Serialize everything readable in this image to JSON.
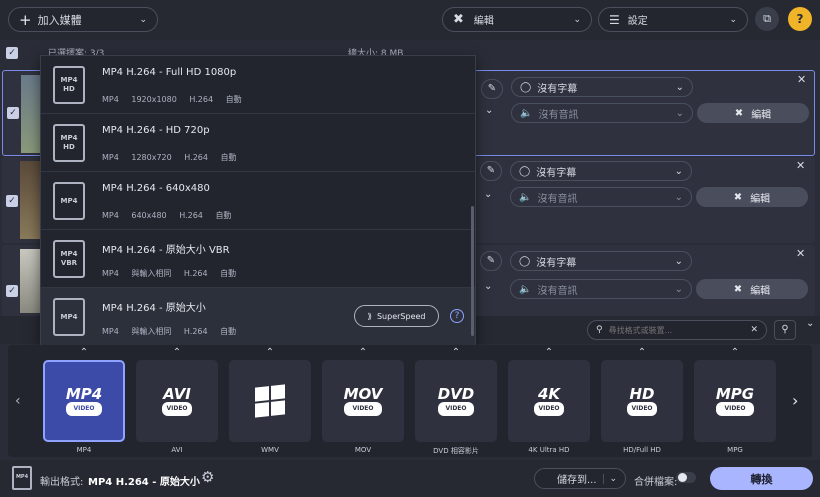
{
  "topbar": {
    "add_media_label": "加入媒體",
    "edit_label": "編輯",
    "settings_label": "設定"
  },
  "listheader": {
    "selected_label": "已選擇案: 3/3",
    "total_size_label": "總大小: 8 MB"
  },
  "rows": [
    {
      "subtitle": "沒有字幕",
      "audio": "沒有音訊",
      "edit": "編輯"
    },
    {
      "subtitle": "沒有字幕",
      "audio": "沒有音訊",
      "edit": "編輯"
    },
    {
      "subtitle": "沒有字幕",
      "audio": "沒有音訊",
      "edit": "編輯"
    }
  ],
  "presets": [
    {
      "icon_top": "MP4",
      "icon_bottom": "HD",
      "title": "MP4 H.264 - Full HD 1080p",
      "meta": [
        "MP4",
        "1920x1080",
        "H.264",
        "自動"
      ]
    },
    {
      "icon_top": "MP4",
      "icon_bottom": "HD",
      "title": "MP4 H.264 - HD 720p",
      "meta": [
        "MP4",
        "1280x720",
        "H.264",
        "自動"
      ]
    },
    {
      "icon_top": "MP4",
      "icon_bottom": "",
      "title": "MP4 H.264 - 640x480",
      "meta": [
        "MP4",
        "640x480",
        "H.264",
        "自動"
      ]
    },
    {
      "icon_top": "MP4",
      "icon_bottom": "VBR",
      "title": "MP4 H.264 - 原始大小 VBR",
      "meta": [
        "MP4",
        "與輸入相同",
        "H.264",
        "自動"
      ]
    },
    {
      "icon_top": "MP4",
      "icon_bottom": "",
      "title": "MP4 H.264 - 原始大小",
      "meta": [
        "MP4",
        "與輸入相同",
        "H.264",
        "自動"
      ]
    }
  ],
  "superspeed_label": "SuperSpeed",
  "search": {
    "placeholder": "尋找格式或裝置..."
  },
  "formats": [
    {
      "logo": "MP4",
      "sub": "VIDEO",
      "label": "MP4"
    },
    {
      "logo": "AVI",
      "sub": "VIDEO",
      "label": "AVI"
    },
    {
      "logo": "WMV",
      "sub": "",
      "label": "WMV"
    },
    {
      "logo": "MOV",
      "sub": "VIDEO",
      "label": "MOV"
    },
    {
      "logo": "DVD",
      "sub": "VIDEO",
      "label": "DVD 相容影片"
    },
    {
      "logo": "4K",
      "sub": "VIDEO",
      "label": "4K Ultra HD"
    },
    {
      "logo": "HD",
      "sub": "VIDEO",
      "label": "HD/Full HD"
    },
    {
      "logo": "MPG",
      "sub": "VIDEO",
      "label": "MPG"
    }
  ],
  "bottom": {
    "output_label": "輸出格式:",
    "output_value": "MP4 H.264 - 原始大小",
    "save_label": "儲存到...",
    "merge_label": "合併檔案:",
    "convert_label": "轉換"
  },
  "colors": {
    "accent": "#8fa2ff",
    "convert_bg": "#a9b5ff",
    "selected_card": "#3d4ba8"
  }
}
